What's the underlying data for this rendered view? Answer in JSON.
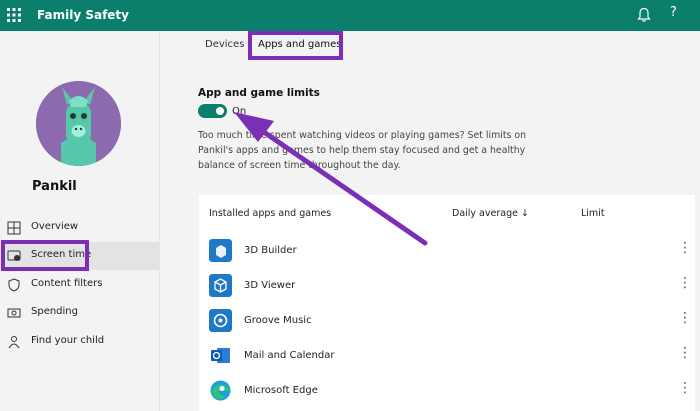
{
  "topbar": {
    "title": "Family Safety",
    "help": "?",
    "accent": "#0c7e6c"
  },
  "sidebar": {
    "child_name": "Pankil",
    "items": [
      {
        "label": "Overview",
        "icon": "overview-icon"
      },
      {
        "label": "Screen time",
        "icon": "screen-time-icon",
        "active": true
      },
      {
        "label": "Content filters",
        "icon": "shield-icon"
      },
      {
        "label": "Spending",
        "icon": "money-icon"
      },
      {
        "label": "Find your child",
        "icon": "person-pin-icon"
      }
    ]
  },
  "tabs": [
    {
      "label": "Devices"
    },
    {
      "label": "Apps and games",
      "active": true
    }
  ],
  "limits": {
    "title": "App and game limits",
    "toggle_state": "On",
    "description": "Too much time spent watching videos or playing games? Set limits on Pankil's apps and games to help them stay focused and get a healthy balance of screen time throughout the day."
  },
  "table": {
    "headers": {
      "apps": "Installed apps and games",
      "daily": "Daily average",
      "sort": "↓",
      "limit": "Limit"
    },
    "rows": [
      {
        "name": "3D Builder",
        "icon": "3d-builder-icon",
        "color": "#1e78c8"
      },
      {
        "name": "3D Viewer",
        "icon": "3d-viewer-icon",
        "color": "#1e78c8"
      },
      {
        "name": "Groove Music",
        "icon": "groove-music-icon",
        "color": "#1e78c8"
      },
      {
        "name": "Mail and Calendar",
        "icon": "mail-calendar-icon",
        "color": "#0a5eb8"
      },
      {
        "name": "Microsoft Edge",
        "icon": "edge-icon",
        "color": "#1fa0d8"
      }
    ]
  },
  "annotation_color": "#7b2fb5"
}
